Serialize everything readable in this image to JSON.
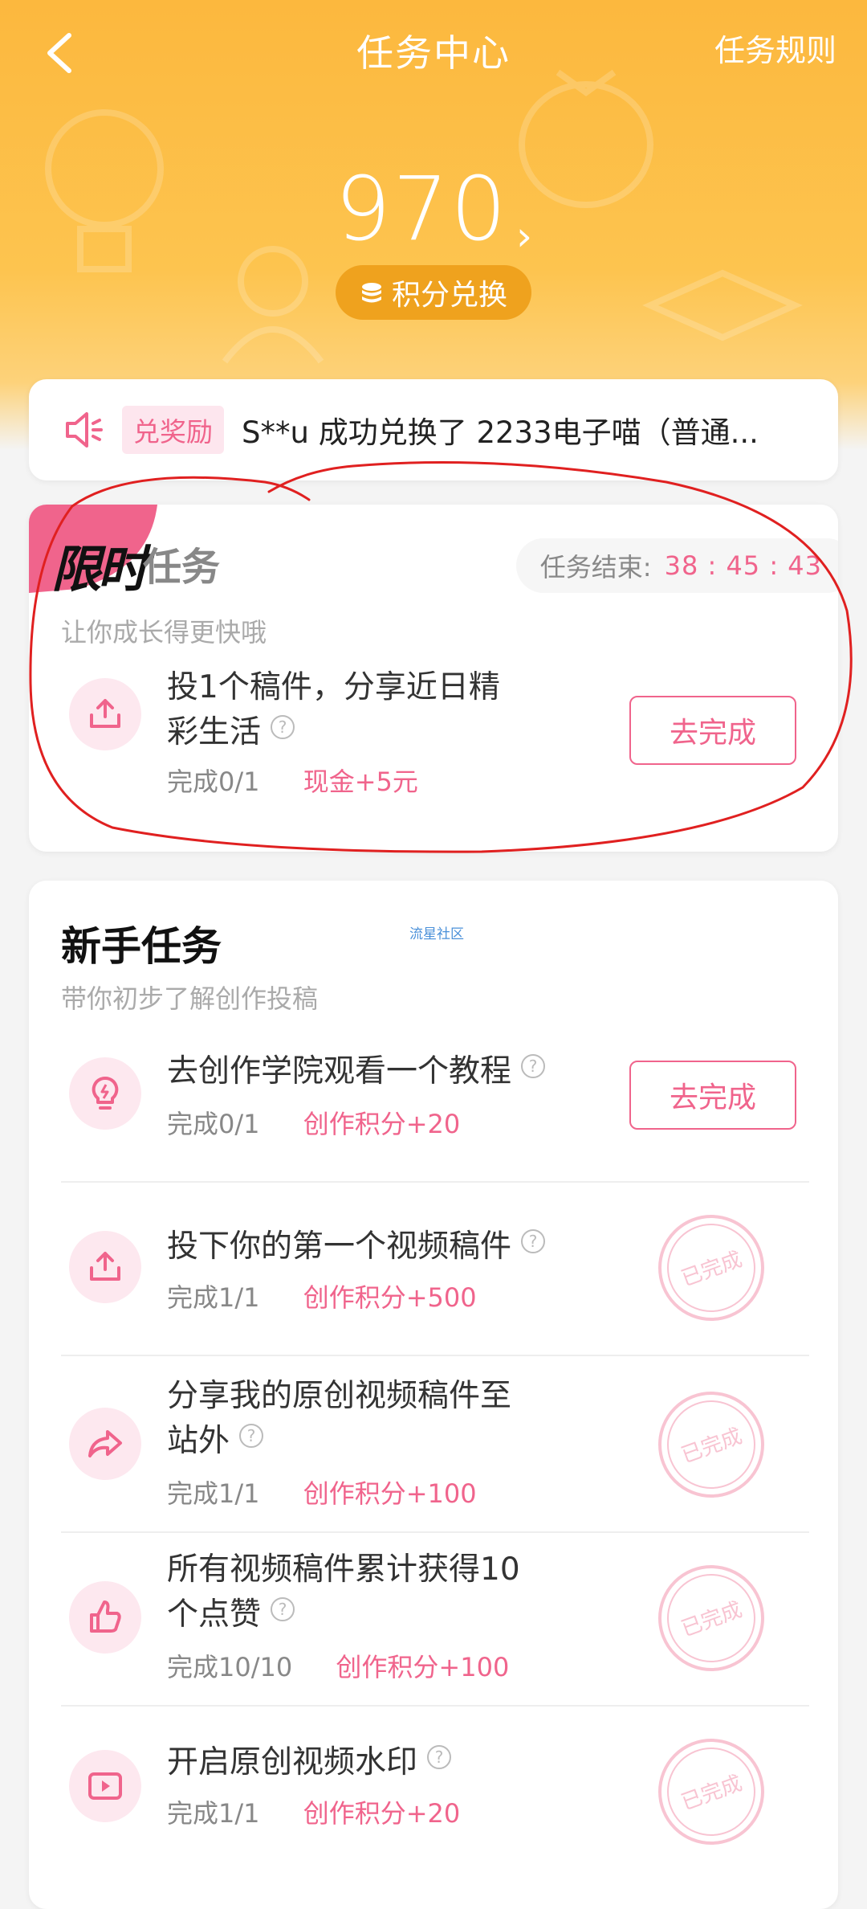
{
  "header": {
    "title": "任务中心",
    "rules_label": "任务规则",
    "points": "970",
    "exchange_label": "积分兑换"
  },
  "notice": {
    "tag": "兑奖励",
    "message": "S**u 成功兑换了 2233电子喵（普通..."
  },
  "limited": {
    "logo": "限时",
    "title": "任务",
    "timer_label": "任务结束:",
    "timer_value": "38 : 45 : 43",
    "subtitle": "让你成长得更快哦",
    "task": {
      "title": "投1个稿件，分享近日精彩生活",
      "progress": "完成0/1",
      "reward": "现金+5元",
      "button": "去完成",
      "icon": "upload-icon"
    }
  },
  "newbie": {
    "title": "新手任务",
    "watermark": "流星社区",
    "subtitle": "带你初步了解创作投稿",
    "tasks": [
      {
        "title": "去创作学院观看一个教程",
        "progress": "完成0/1",
        "reward": "创作积分+20",
        "button": "去完成",
        "icon": "lightbulb-icon",
        "done": false
      },
      {
        "title": "投下你的第一个视频稿件",
        "progress": "完成1/1",
        "reward": "创作积分+500",
        "icon": "upload-icon",
        "done": true
      },
      {
        "title": "分享我的原创视频稿件至站外",
        "progress": "完成1/1",
        "reward": "创作积分+100",
        "icon": "share-icon",
        "done": true
      },
      {
        "title": "所有视频稿件累计获得10个点赞",
        "progress": "完成10/10",
        "reward": "创作积分+100",
        "icon": "thumbs-up-icon",
        "done": true
      },
      {
        "title": "开启原创视频水印",
        "progress": "完成1/1",
        "reward": "创作积分+20",
        "icon": "video-icon",
        "done": true
      }
    ],
    "stamp_text": "已完成"
  },
  "colors": {
    "accent": "#f0648c",
    "header_orange": "#fcb83e",
    "annotation_red": "#e02020"
  }
}
